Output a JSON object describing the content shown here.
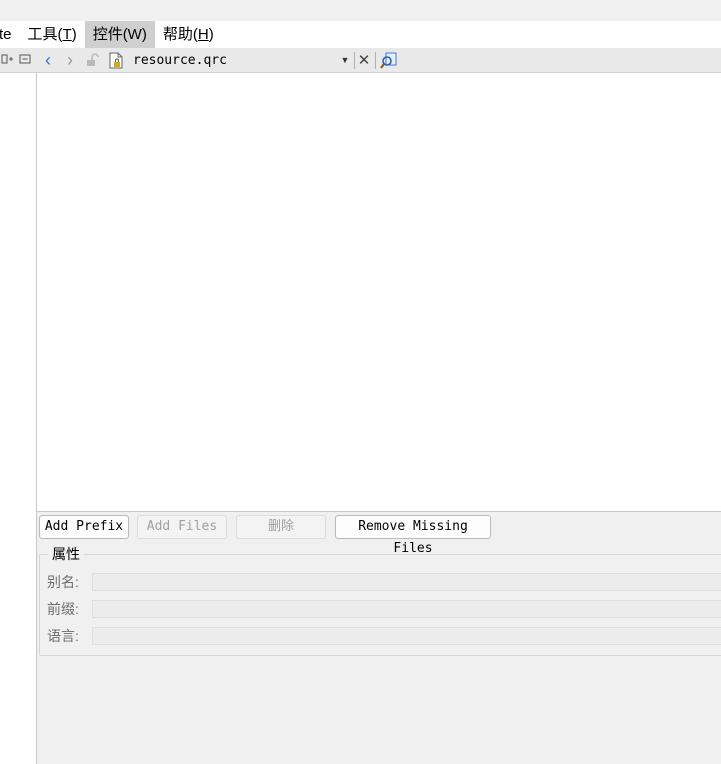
{
  "menubar": {
    "items": [
      {
        "label": "te",
        "mnemonic": "",
        "suffix": ""
      },
      {
        "label": "工具(",
        "mnemonic": "T",
        "suffix": ")"
      },
      {
        "label": "控件(W)",
        "mnemonic": "",
        "suffix": ""
      },
      {
        "label": "帮助(",
        "mnemonic": "H",
        "suffix": ")"
      }
    ]
  },
  "left_toolbar": {
    "split_icon": "split-add-icon",
    "collapse_icon": "collapse-icon"
  },
  "editor_toolbar": {
    "file_name": "resource.qrc",
    "icons": {
      "back": "‹",
      "forward": "›",
      "close": "✕",
      "dropdown": "▼"
    }
  },
  "resource_buttons": {
    "add_prefix": "Add Prefix",
    "add_files": "Add Files",
    "delete": "删除",
    "remove_missing": "Remove Missing Files"
  },
  "properties": {
    "title": "属性",
    "alias_label": "别名:",
    "prefix_label": "前缀:",
    "language_label": "语言:",
    "alias_value": "",
    "prefix_value": "",
    "language_value": ""
  },
  "colors": {
    "accent": "#3a78d6",
    "menu_active": "#cfcfcf",
    "lock": "#d6a817"
  }
}
